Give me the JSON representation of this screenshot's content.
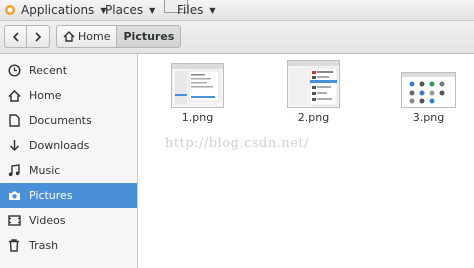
{
  "topbar": {
    "applications_label": "Applications",
    "places_label": "Places",
    "files_label": "Files"
  },
  "header": {
    "back_icon": "chevron-left-icon",
    "forward_icon": "chevron-right-icon",
    "breadcrumbs": [
      {
        "label": "Home",
        "icon": "home-icon"
      },
      {
        "label": "Pictures"
      }
    ]
  },
  "sidebar": {
    "items": [
      {
        "label": "Recent",
        "icon": "clock-icon"
      },
      {
        "label": "Home",
        "icon": "home-icon"
      },
      {
        "label": "Documents",
        "icon": "document-icon"
      },
      {
        "label": "Downloads",
        "icon": "download-icon"
      },
      {
        "label": "Music",
        "icon": "music-icon"
      },
      {
        "label": "Pictures",
        "icon": "camera-icon",
        "selected": true
      },
      {
        "label": "Videos",
        "icon": "video-icon"
      },
      {
        "label": "Trash",
        "icon": "trash-icon"
      }
    ]
  },
  "files": [
    {
      "name": "1.png"
    },
    {
      "name": "2.png"
    },
    {
      "name": "3.png"
    }
  ],
  "watermark": "http://blog.csdn.net/",
  "colors": {
    "selection": "#4a90d9",
    "sidebar_bg": "#f6f6f6"
  }
}
